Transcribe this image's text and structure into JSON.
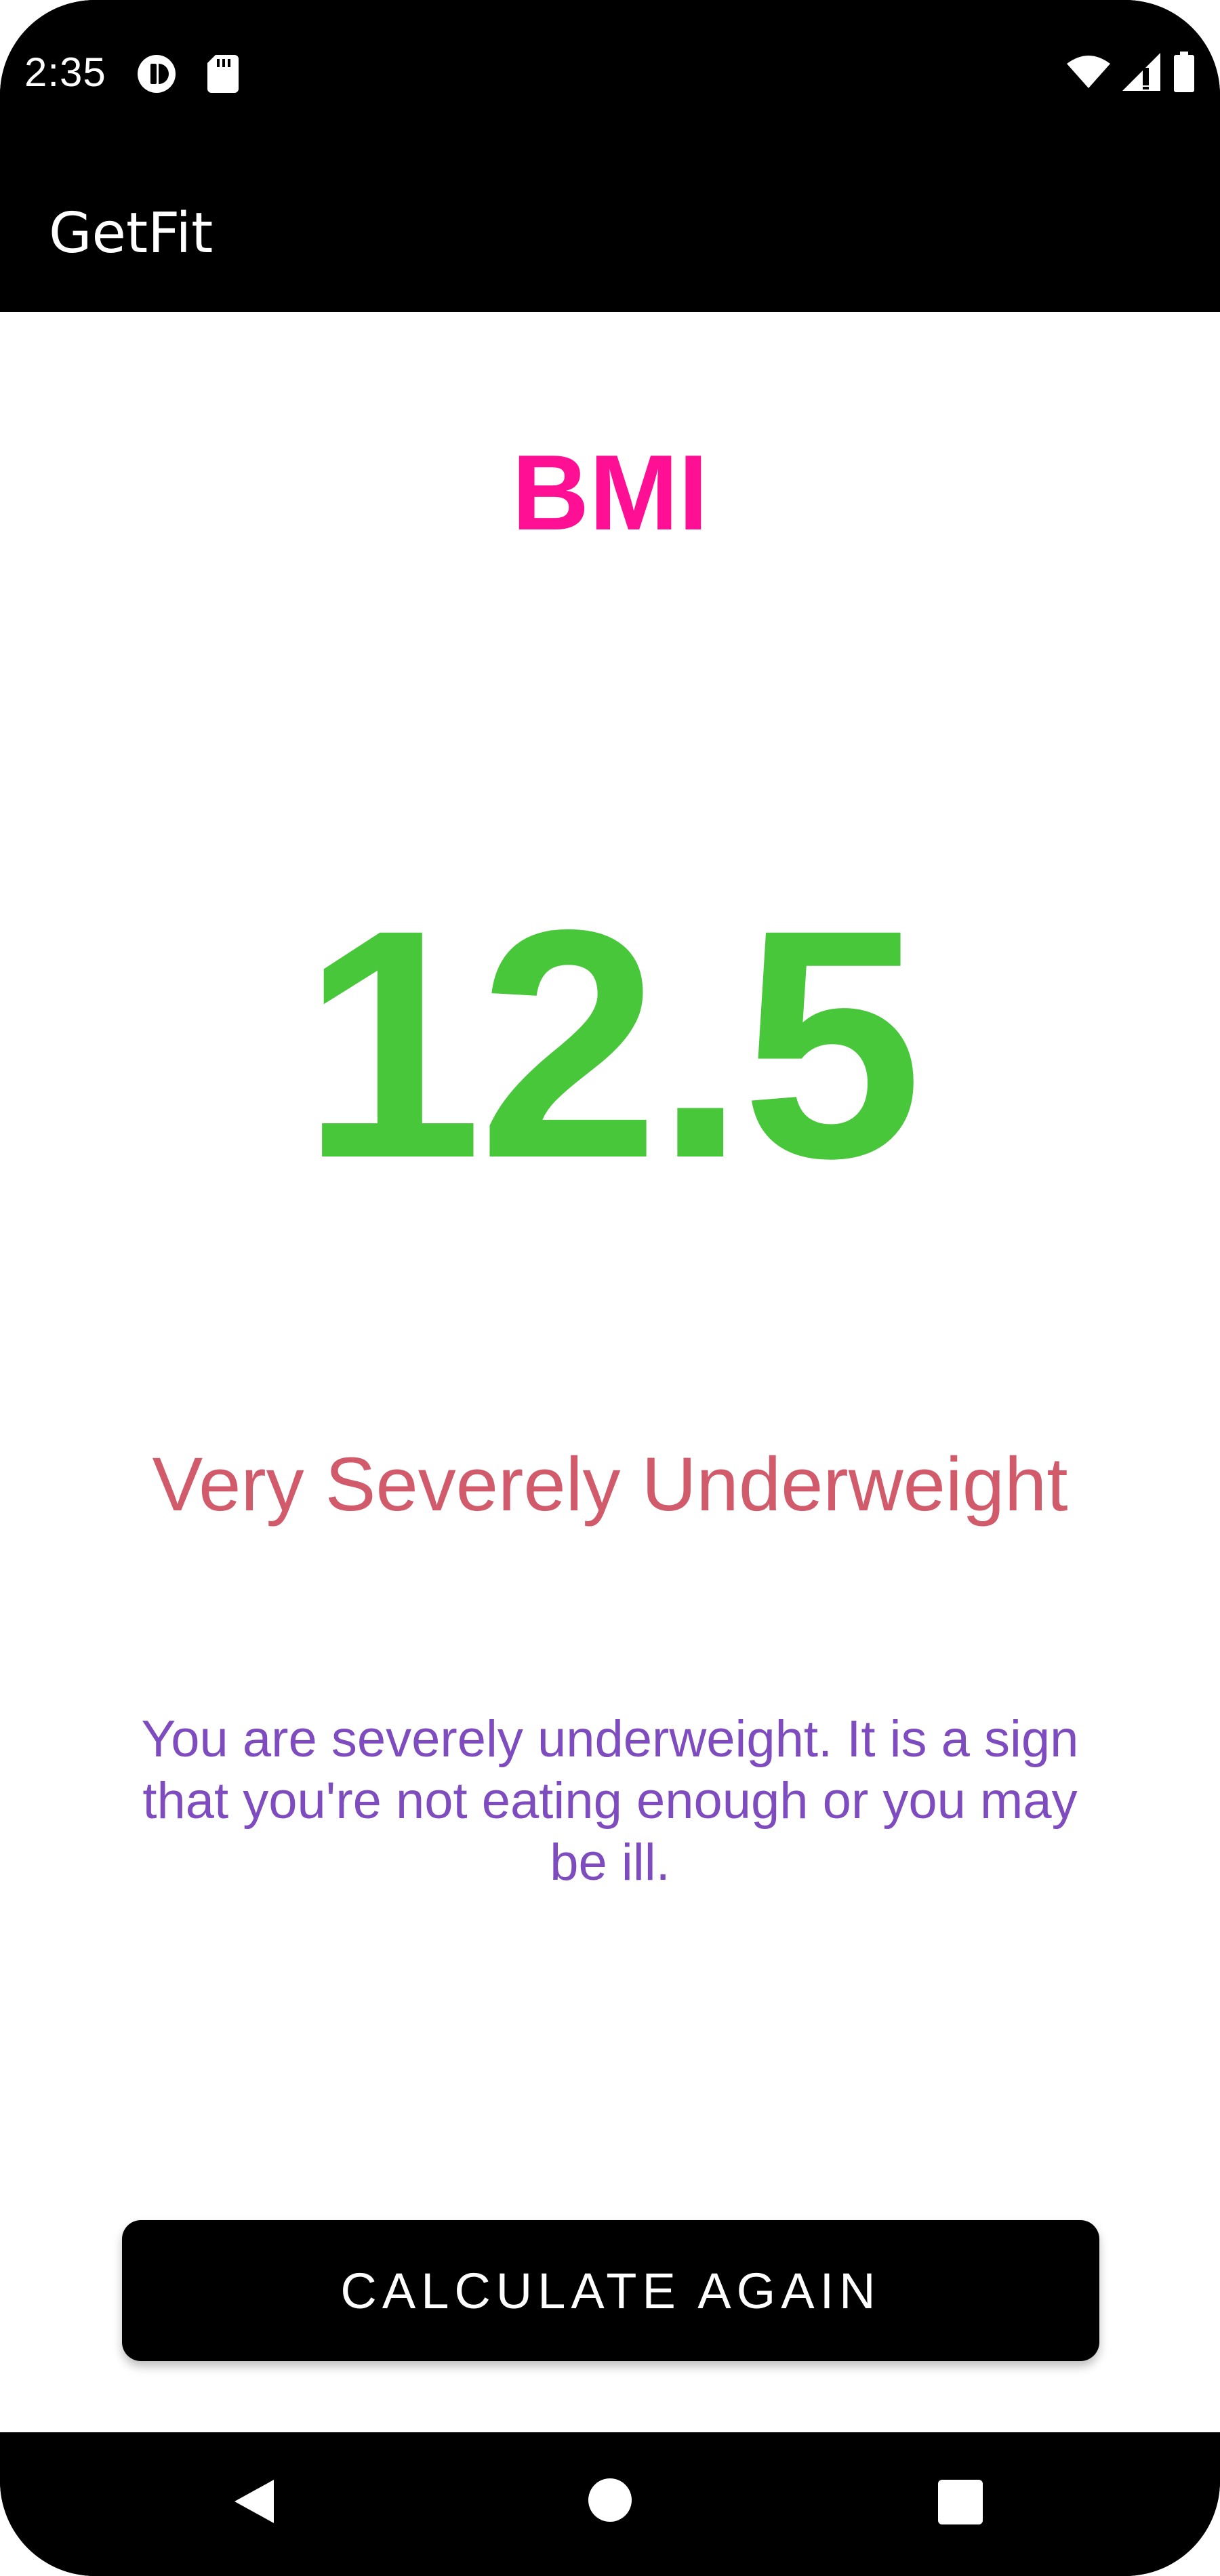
{
  "status_bar": {
    "time": "2:35",
    "left_icons": [
      "data-saver-icon",
      "sd-card-icon"
    ],
    "right_icons": [
      "wifi-icon",
      "signal-icon",
      "battery-icon"
    ]
  },
  "app_bar": {
    "title": "GetFit"
  },
  "result": {
    "title": "BMI",
    "value": "12.5",
    "category": "Very Severely Underweight",
    "message": "You are severely underweight. It is a sign that you're not eating enough or you may be ill."
  },
  "actions": {
    "calculate_again_label": "CALCULATE AGAIN"
  },
  "nav_bar": {
    "buttons": [
      "back-icon",
      "home-icon",
      "recents-icon"
    ]
  },
  "colors": {
    "title": "#ff0f93",
    "value": "#48c73b",
    "category": "#d15a6b",
    "message": "#7e4cbf",
    "button_bg": "#000000",
    "button_text": "#ffffff"
  }
}
